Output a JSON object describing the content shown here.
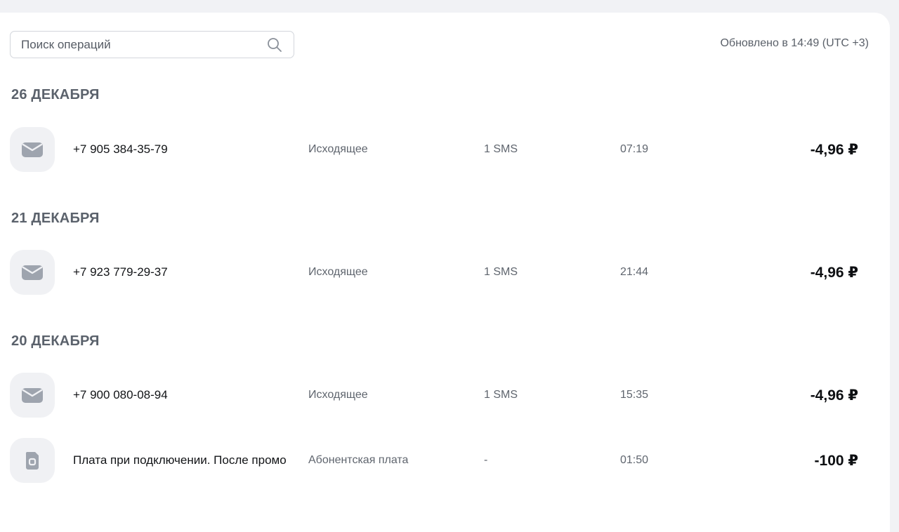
{
  "search": {
    "placeholder": "Поиск операций",
    "value": ""
  },
  "updated_text": "Обновлено в 14:49 (UTC +3)",
  "groups": [
    {
      "date": "26 ДЕКАБРЯ",
      "items": [
        {
          "icon": "envelope-icon",
          "title": "+7 905 384-35-79",
          "kind": "Исходящее",
          "qty": "1 SMS",
          "time": "07:19",
          "amount": "-4,96 ₽"
        }
      ]
    },
    {
      "date": "21 ДЕКАБРЯ",
      "items": [
        {
          "icon": "envelope-icon",
          "title": "+7 923 779-29-37",
          "kind": "Исходящее",
          "qty": "1 SMS",
          "time": "21:44",
          "amount": "-4,96 ₽"
        }
      ]
    },
    {
      "date": "20 ДЕКАБРЯ",
      "items": [
        {
          "icon": "envelope-icon",
          "title": "+7 900 080-08-94",
          "kind": "Исходящее",
          "qty": "1 SMS",
          "time": "15:35",
          "amount": "-4,96 ₽"
        },
        {
          "icon": "sim-card-icon",
          "title": "Плата при подключении. После промо",
          "kind": "Абонентская плата",
          "qty": "-",
          "time": "01:50",
          "amount": "-100 ₽"
        }
      ]
    }
  ],
  "colors": {
    "background": "#f1f2f5",
    "card": "#ffffff",
    "icon_box": "#f0f1f4",
    "icon": "#9ea4ae",
    "heading": "#5b626c",
    "muted_text": "#5f656e"
  }
}
